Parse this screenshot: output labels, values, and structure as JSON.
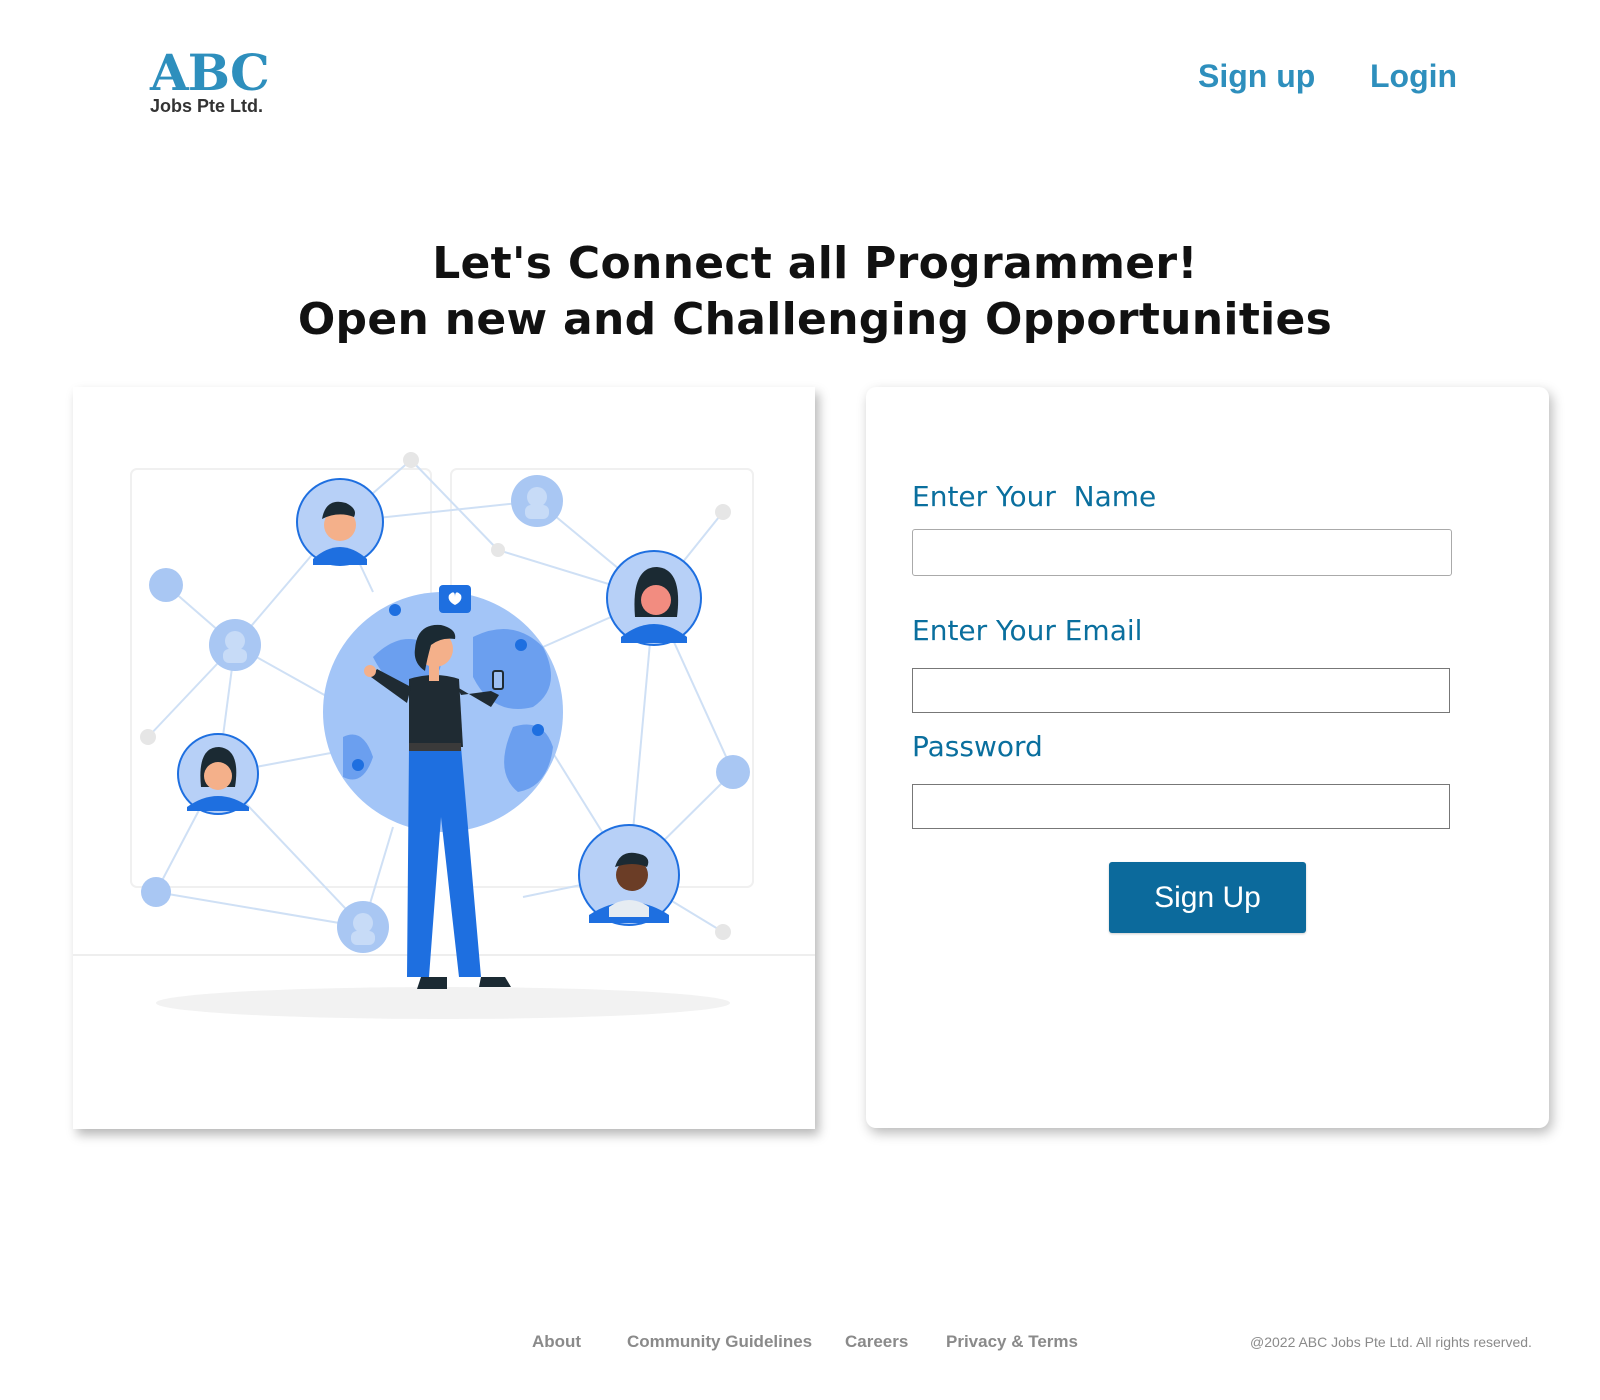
{
  "brand": {
    "name": "ABC",
    "subtitle": "Jobs Pte Ltd.",
    "color": "#2e8fbd"
  },
  "nav": {
    "signup": "Sign up",
    "login": "Login"
  },
  "hero": {
    "line1": "Let's Connect all Programmer!",
    "line2": "Open new and Challenging Opportunities"
  },
  "illustration": {
    "subject": "woman-on-globe-network-illustration"
  },
  "form": {
    "name_label": "Enter Your  Name",
    "name_value": "",
    "email_label": "Enter Your Email",
    "email_value": "",
    "password_label": "Password",
    "password_value": "",
    "submit": "Sign Up",
    "label_color": "#0a6f9e",
    "button_color": "#0c6a9c"
  },
  "footer": {
    "links": [
      "About",
      "Community Guidelines",
      "Careers",
      "Privacy & Terms"
    ],
    "copyright": "@2022 ABC Jobs Pte Ltd. All rights reserved."
  }
}
